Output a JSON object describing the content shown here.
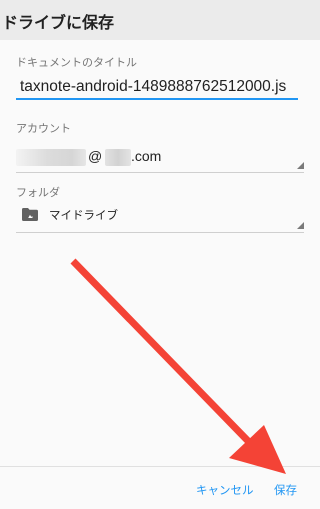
{
  "dialog": {
    "title": "ドライブに保存",
    "document_title_label": "ドキュメントのタイトル",
    "document_title_value": "taxnote-android-1489888762512000.js",
    "account_label": "アカウント",
    "account_at": "@",
    "account_domain": ".com",
    "folder_label": "フォルダ",
    "folder_value": "マイドライブ",
    "cancel_label": "キャンセル",
    "save_label": "保存"
  },
  "colors": {
    "accent": "#2196f3",
    "annotation_arrow": "#f44336"
  },
  "icons": {
    "folder": "drive-folder-icon",
    "dropdown": "dropdown-caret-icon",
    "annotation": "red-arrow-annotation"
  }
}
